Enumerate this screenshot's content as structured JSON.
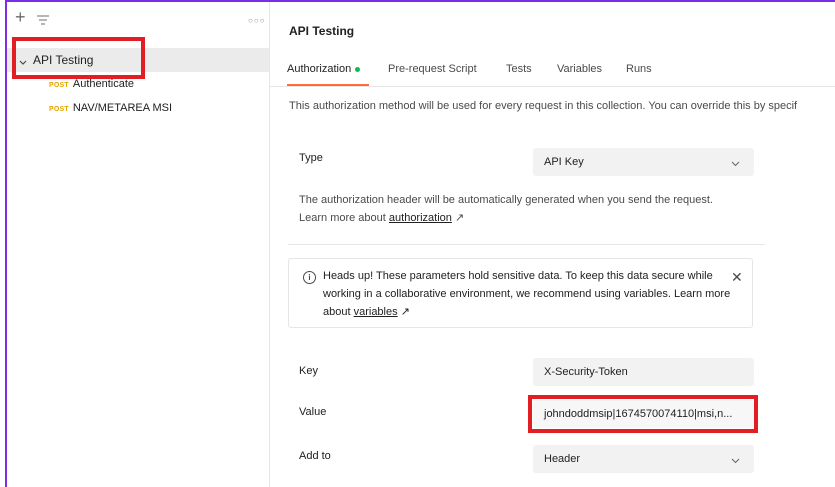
{
  "sidebar": {
    "plus_icon": "+",
    "collection": {
      "name": "API Testing"
    },
    "requests": [
      {
        "method": "POST",
        "name": "Authenticate"
      },
      {
        "method": "POST",
        "name": "NAV/METAREA MSI"
      }
    ]
  },
  "main": {
    "title": "API Testing",
    "tabs": [
      {
        "label": "Authorization",
        "active": true
      },
      {
        "label": "Pre-request Script"
      },
      {
        "label": "Tests"
      },
      {
        "label": "Variables"
      },
      {
        "label": "Runs"
      }
    ],
    "description": "This authorization method will be used for every request in this collection. You can override this by specif",
    "type": {
      "label": "Type",
      "value": "API Key"
    },
    "help_text": "The authorization header will be automatically generated when you send the request. Learn more about",
    "help_link": "authorization",
    "alert": {
      "text": "Heads up! These parameters hold sensitive data. To keep this data secure while working in a collaborative environment, we recommend using variables. Learn more about",
      "link": "variables"
    },
    "key": {
      "label": "Key",
      "value": "X-Security-Token"
    },
    "value": {
      "label": "Value",
      "value": "johndoddmsip|1674570074110|msi,n..."
    },
    "add_to": {
      "label": "Add to",
      "value": "Header"
    }
  },
  "colors": {
    "accent": "#ff6c37",
    "highlight": "#e01e24",
    "frame": "#7b2ee6",
    "status_dot": "#0cbb52",
    "method": "#e6a400"
  }
}
